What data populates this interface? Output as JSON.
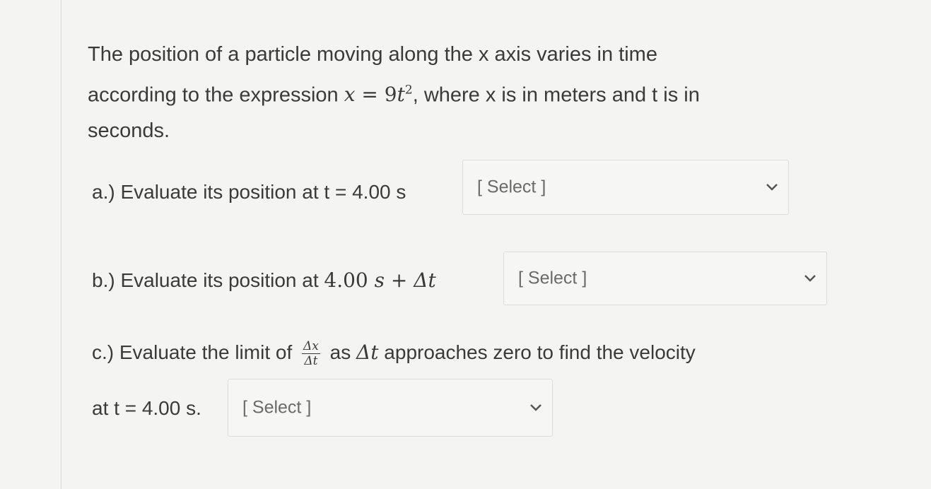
{
  "question": {
    "line1": "The position of a particle moving along the x axis varies in time",
    "line2_pre": "according to the expression ",
    "expr_x": "x",
    "expr_eq": " = ",
    "expr_coef": "9",
    "expr_t": "t",
    "expr_pow": "2",
    "line2_post": ", where x is in meters and t is in",
    "line3": "seconds."
  },
  "part_a": {
    "label": "a.) Evaluate its position at t = 4.00 s",
    "select_placeholder": "[ Select ]"
  },
  "part_b": {
    "label_pre": "b.) Evaluate its position at ",
    "math_val": "4.00 ",
    "math_s": "s",
    "math_plus": " + ",
    "math_delta": "Δt",
    "select_placeholder": "[ Select ]"
  },
  "part_c": {
    "label_pre": "c.) Evaluate the limit of ",
    "frac_num": "Δx",
    "frac_den": "Δt",
    "label_mid": " as ",
    "math_delta": "Δt",
    "label_post": " approaches zero to find the velocity",
    "line2": "at t = 4.00 s.",
    "select_placeholder": "[ Select ]"
  },
  "icons": {
    "dropdown": "chevron-down-icon"
  },
  "colors": {
    "background": "#f4f4f2",
    "text": "#3a3a3a",
    "placeholder": "#6a6a6a",
    "border": "#dcdcdc"
  }
}
